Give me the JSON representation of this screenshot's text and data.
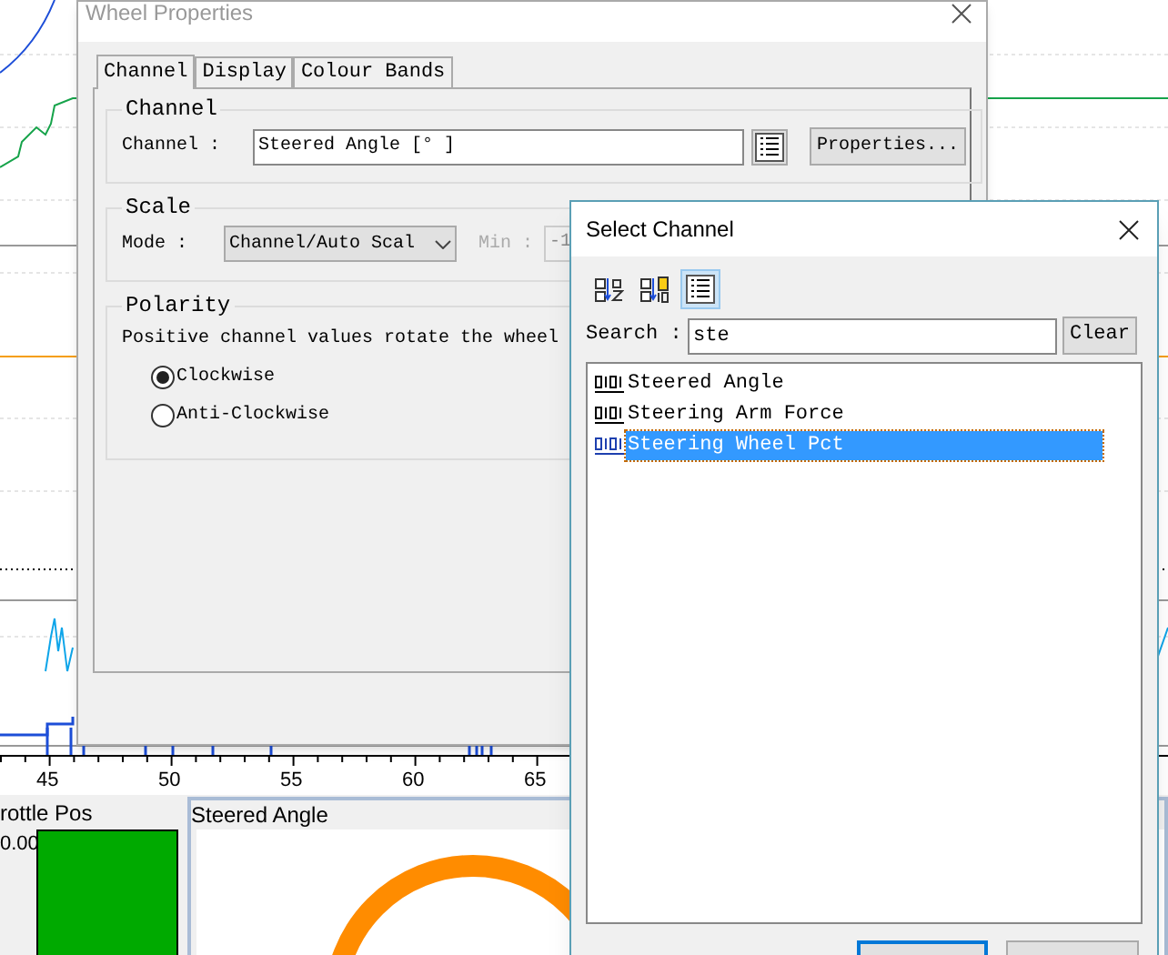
{
  "background_app": {
    "time_axis_labels": [
      "45",
      "50",
      "55",
      "60",
      "65"
    ],
    "panels": [
      {
        "kind": "bar",
        "title": "rottle Pos",
        "reading": "0.00",
        "level": 1
      },
      {
        "kind": "wheel",
        "title": "Steered Angle"
      }
    ]
  },
  "wheel_properties": {
    "title": "Wheel Properties",
    "tabs": [
      {
        "label": "Channel",
        "selected": true
      },
      {
        "label": "Display",
        "selected": false
      },
      {
        "label": "Colour Bands",
        "selected": false
      }
    ],
    "channel_group": {
      "title": "Channel",
      "label": "Channel :",
      "value": "Steered Angle [° ]",
      "button": "Properties..."
    },
    "scale_group": {
      "title": "Scale",
      "mode_label": "Mode :",
      "mode_value": "Channel/Auto Scal",
      "min_label": "Min :",
      "min_value": "-1"
    },
    "polarity_group": {
      "title": "Polarity",
      "text": "Positive channel values rotate the wheel",
      "options": [
        {
          "label": "Clockwise",
          "selected": true
        },
        {
          "label": "Anti-Clockwise",
          "selected": false
        }
      ]
    }
  },
  "select_channel": {
    "title": "Select Channel",
    "toolbar": [
      {
        "kind": "sort-alpha",
        "selected": false
      },
      {
        "kind": "sort-type",
        "selected": false
      },
      {
        "kind": "list",
        "selected": true
      }
    ],
    "search": {
      "label": "Search :",
      "value": "ste",
      "button": "Clear"
    },
    "items": [
      {
        "label": "Steered Angle",
        "selected": false
      },
      {
        "label": "Steering Arm Force",
        "selected": false
      },
      {
        "label": "Steering Wheel Pct",
        "selected": true
      }
    ]
  }
}
